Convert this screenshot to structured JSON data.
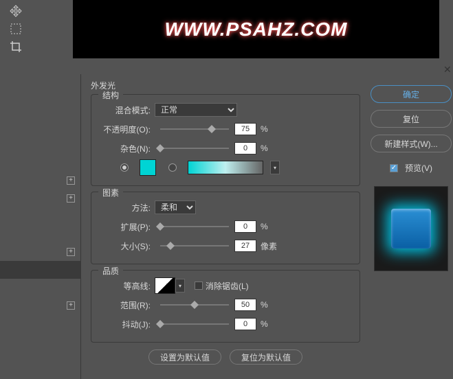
{
  "bg_text": "WWW.PSAHZ.COM",
  "panel_title": "外发光",
  "struct": {
    "legend": "结构",
    "blend_label": "混合模式:",
    "blend_value": "正常",
    "opacity_label": "不透明度(O):",
    "opacity_value": "75",
    "noise_label": "杂色(N):",
    "noise_value": "0"
  },
  "elements": {
    "legend": "图素",
    "method_label": "方法:",
    "method_value": "柔和",
    "spread_label": "扩展(P):",
    "spread_value": "0",
    "size_label": "大小(S):",
    "size_value": "27",
    "size_unit": "像素"
  },
  "quality": {
    "legend": "品质",
    "contour_label": "等高线:",
    "alias_label": "消除锯齿(L)",
    "range_label": "范围(R):",
    "range_value": "50",
    "jitter_label": "抖动(J):",
    "jitter_value": "0"
  },
  "percent": "%",
  "btn_default": "设置为默认值",
  "btn_reset_default": "复位为默认值",
  "right": {
    "ok": "确定",
    "reset": "复位",
    "new_style": "新建样式(W)...",
    "preview": "预览(V)"
  }
}
